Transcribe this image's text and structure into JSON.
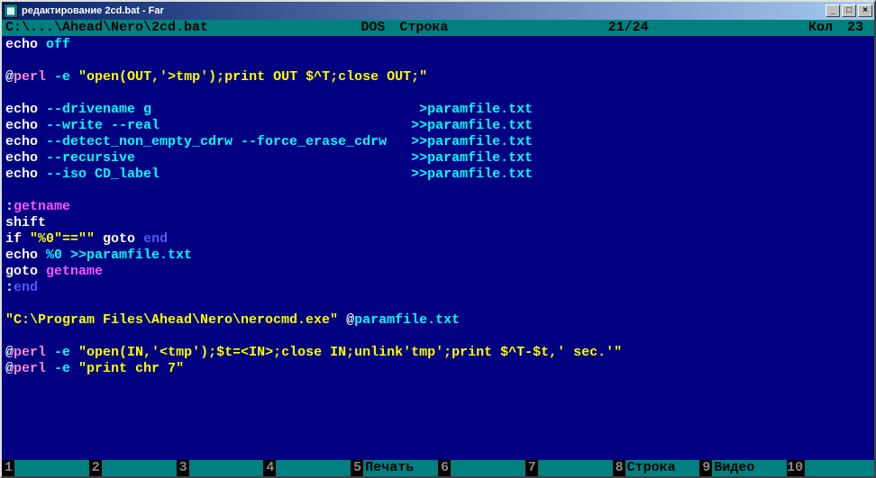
{
  "window": {
    "title": "редактирование 2cd.bat - Far"
  },
  "status": {
    "path": "C:\\...\\Ahead\\Nero\\2cd.bat",
    "mode": "DOS",
    "line_label": "Строка",
    "line_pos": "21/24",
    "col_label": "Кол",
    "col_pos": "23"
  },
  "code": {
    "l1_a": "echo",
    "l1_b": " off",
    "l2": " ",
    "l3_a": "@",
    "l3_b": "perl",
    "l3_c": " -e ",
    "l3_d": "\"open(OUT,'>tmp');print OUT $^T;close OUT;\"",
    "l4": " ",
    "l5_a": "echo",
    "l5_b": " --drivename g                                 >paramfile.txt",
    "l6_a": "echo",
    "l6_b": " --write --real                               >>paramfile.txt",
    "l7_a": "echo",
    "l7_b": " --detect_non_empty_cdrw --force_erase_cdrw   >>paramfile.txt",
    "l8_a": "echo",
    "l8_b": " --recursive                                  >>paramfile.txt",
    "l9_a": "echo",
    "l9_b": " --iso CD_label                               >>paramfile.txt",
    "l10": " ",
    "l11_a": ":",
    "l11_b": "getname",
    "l12": "shift",
    "l13_a": "if",
    "l13_b": " \"%0\"==\"\" ",
    "l13_c": "goto",
    "l13_d": " ",
    "l13_e": "end",
    "l14_a": "echo",
    "l14_b": " %0 >>paramfile.txt",
    "l15_a": "goto",
    "l15_b": " ",
    "l15_c": "getname",
    "l16_a": ":",
    "l16_b": "end",
    "l17": " ",
    "l18_a": "\"C:\\Program Files\\Ahead\\Nero\\nerocmd.exe\"",
    "l18_b": " @",
    "l18_c": "paramfile.txt",
    "l19": " ",
    "l20_a": "@",
    "l20_b": "perl",
    "l20_c": " -e ",
    "l20_d": "\"open(IN,'<tmp');$t=<IN>;close IN;unlink'tmp';print $^T-$t,' sec.'\"",
    "l21_a": "@",
    "l21_b": "perl",
    "l21_c": " -e ",
    "l21_d": "\"print chr 7\""
  },
  "fkeys": {
    "k1n": "1",
    "k1l": "      ",
    "k2n": "2",
    "k2l": "      ",
    "k3n": "3",
    "k3l": "      ",
    "k4n": "4",
    "k4l": "      ",
    "k5n": "5",
    "k5l": "Печать",
    "k6n": "6",
    "k6l": "      ",
    "k7n": "7",
    "k7l": "      ",
    "k8n": "8",
    "k8l": "Строка",
    "k9n": "9",
    "k9l": "Видео ",
    "k10n": "10",
    "k10l": "      "
  }
}
